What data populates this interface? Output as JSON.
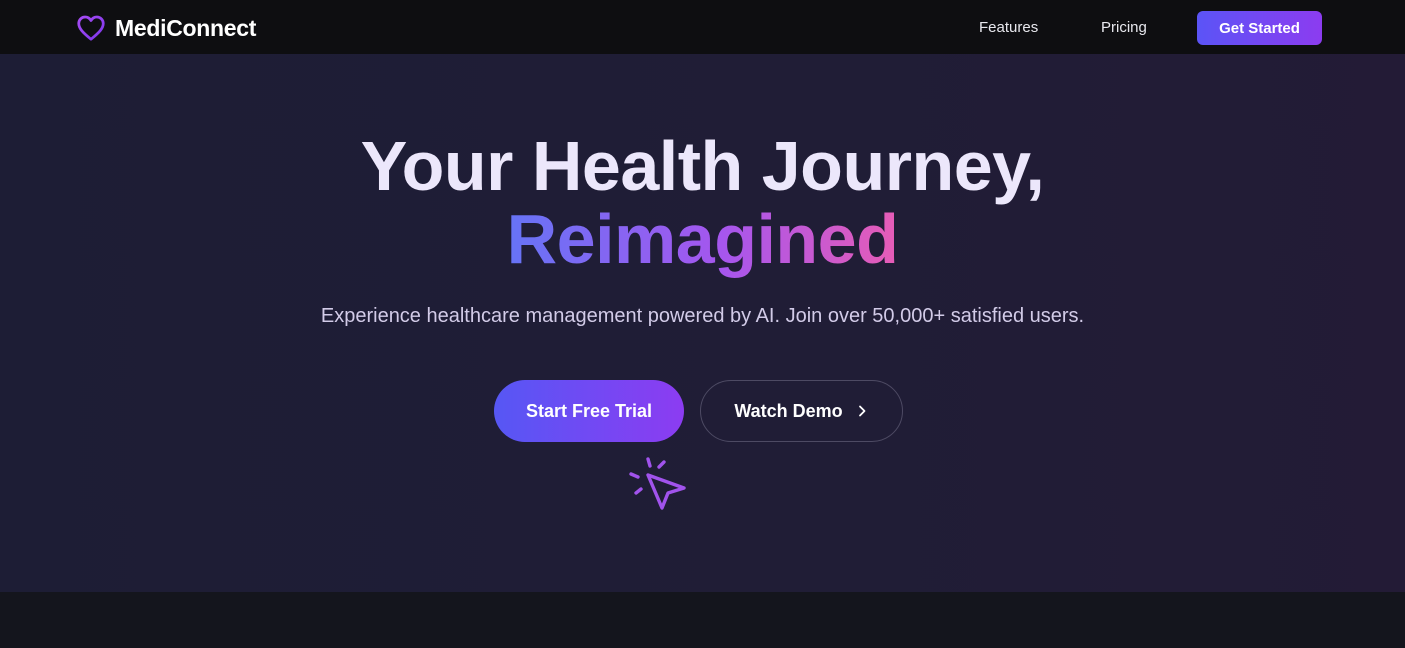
{
  "nav": {
    "brand": "MediConnect",
    "brand_icon": "heart-icon",
    "links": [
      "Features",
      "Pricing"
    ],
    "cta": "Get Started"
  },
  "hero": {
    "title_line1": "Your Health Journey,",
    "title_line2": "Reimagined",
    "subtitle": "Experience healthcare management powered by AI. Join over 50,000+ satisfied users.",
    "primary_cta": "Start Free Trial",
    "secondary_cta": "Watch Demo",
    "secondary_icon": "chevron-right-icon",
    "pointer_icon": "click-pointer-icon"
  },
  "colors": {
    "accent_start": "#5b54f6",
    "accent_end": "#8c3cf0",
    "gradient_text": [
      "#6674f6",
      "#a656ee",
      "#e75cb6"
    ],
    "nav_background": "#0e0e11",
    "hero_background": "#1d1d35"
  }
}
